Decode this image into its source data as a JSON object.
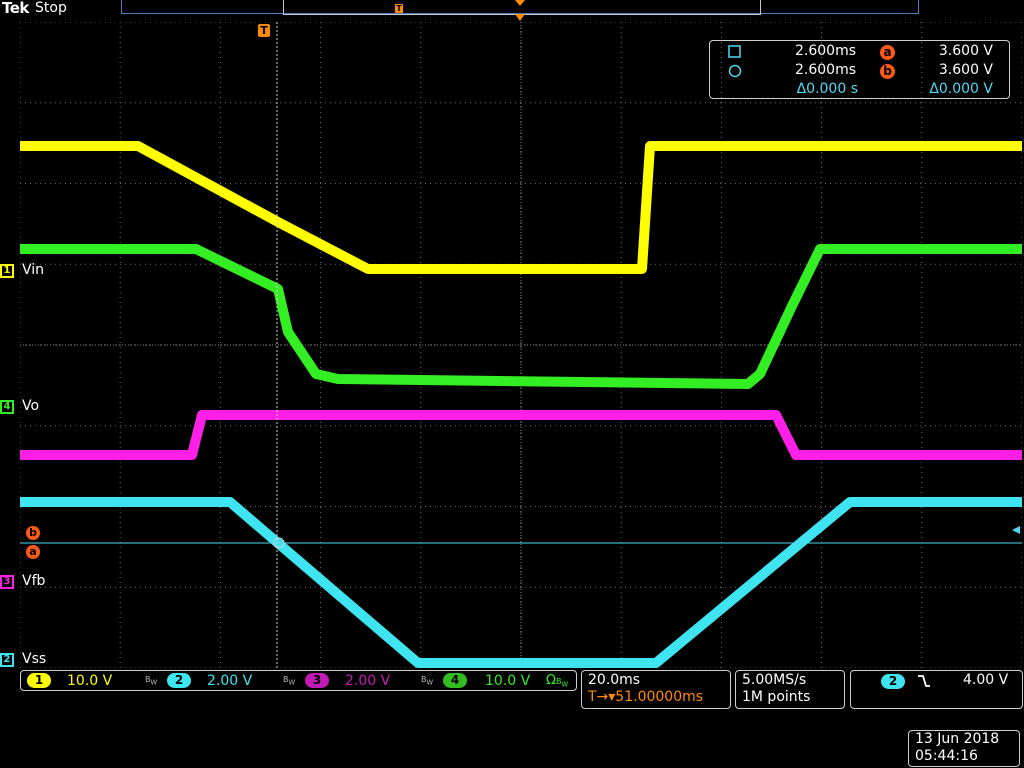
{
  "header": {
    "brand": "Tek",
    "run_status": "Stop"
  },
  "icons": {
    "trigger": "trigger-position-icon",
    "cursor_a": "cursor-a-icon",
    "cursor_b": "cursor-b-icon"
  },
  "trigger_marker_letter": "T",
  "cursor_readout": {
    "row1": {
      "symbol": "square",
      "time": "2.600ms",
      "badge": "a",
      "value": "3.600 V"
    },
    "row2": {
      "symbol": "circle",
      "time": "2.600ms",
      "badge": "b",
      "value": "3.600 V"
    },
    "row3": {
      "delta_time": "Δ0.000 s",
      "delta_value": "Δ0.000 V"
    }
  },
  "channels": [
    {
      "id": "1",
      "name": "Vin",
      "scale": "10.0 V",
      "color": "#ffff00"
    },
    {
      "id": "2",
      "name": "Vss",
      "scale": "2.00 V",
      "color": "#3ee5f0"
    },
    {
      "id": "3",
      "name": "Vfb",
      "scale": "2.00 V",
      "color": "#ff1fe6"
    },
    {
      "id": "4",
      "name": "Vo",
      "scale": "10.0 V",
      "color": "#33ee22"
    }
  ],
  "cursor_markers": {
    "a": "a",
    "b": "b"
  },
  "timebase": {
    "scale": "20.0ms",
    "position": "T→▾51.00000ms"
  },
  "acquisition": {
    "sample_rate": "5.00MS/s",
    "record_length": "1M points"
  },
  "trigger": {
    "source": "2",
    "slope": "falling",
    "level": "4.00 V"
  },
  "datetime": {
    "date": "13 Jun 2018",
    "time": "05:44:16"
  },
  "colors": {
    "accent_orange": "#ff8c00",
    "cursor_orange": "#ff5a1a",
    "cursor_line": "#4dd9f2"
  }
}
